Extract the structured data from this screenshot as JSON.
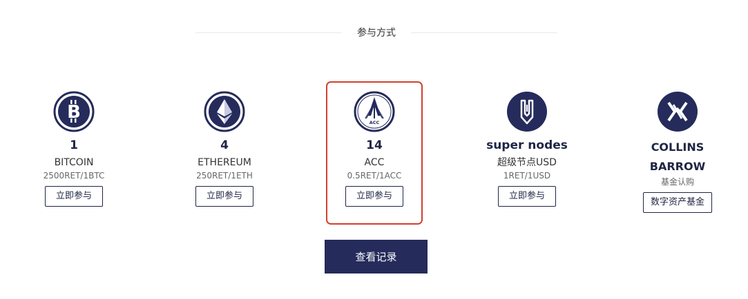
{
  "section": {
    "title": "参与方式"
  },
  "colors": {
    "navy": "#252b5b",
    "highlight": "#d0412d"
  },
  "cards": [
    {
      "count": "1",
      "name": "BITCOIN",
      "rate": "2500RET/1BTC",
      "button": "立即参与",
      "icon": "bitcoin-icon"
    },
    {
      "count": "4",
      "name": "ETHEREUM",
      "rate": "250RET/1ETH",
      "button": "立即参与",
      "icon": "ethereum-icon"
    },
    {
      "count": "14",
      "name": "ACC",
      "rate": "0.5RET/1ACC",
      "button": "立即参与",
      "icon": "acc-logo-icon",
      "highlighted": true
    },
    {
      "count": "super nodes",
      "name": "超级节点USD",
      "rate": "1RET/1USD",
      "button": "立即参与",
      "icon": "pen-nib-icon"
    },
    {
      "count": "COLLINS BARROW",
      "name": "",
      "rate": "基金认购",
      "button": "数字资产基金",
      "icon": "collins-barrow-logo-icon"
    }
  ],
  "acc_logo_text": "ACC",
  "records_button": "查看记录"
}
